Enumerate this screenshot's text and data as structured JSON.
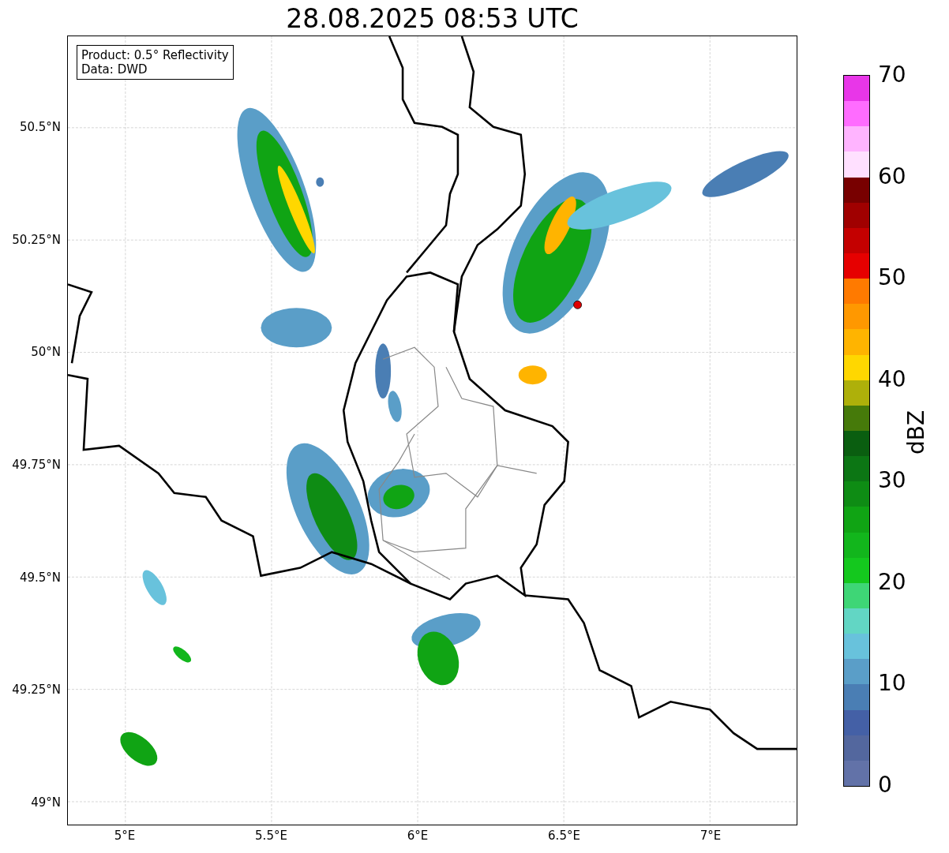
{
  "title": "28.08.2025 08:53 UTC",
  "info_box": {
    "lines": [
      "Product: 0.5° Reflectivity",
      "Data: DWD"
    ]
  },
  "map": {
    "lat_labels": [
      "50.5°N",
      "50.25°N",
      "50°N",
      "49.75°N",
      "49.5°N",
      "49.25°N",
      "49°N"
    ],
    "lon_labels": [
      "5°E",
      "5.5°E",
      "6°E",
      "6.5°E",
      "7°E"
    ]
  },
  "colorbar": {
    "label": "dBZ",
    "ticks": [
      "70",
      "60",
      "50",
      "40",
      "30",
      "20",
      "10",
      "0"
    ],
    "bands": [
      {
        "color": "#e836e8"
      },
      {
        "color": "#ff6cff"
      },
      {
        "color": "#ffb4ff"
      },
      {
        "color": "#ffe0ff"
      },
      {
        "color": "#780000"
      },
      {
        "color": "#a00000"
      },
      {
        "color": "#c40000"
      },
      {
        "color": "#e60000"
      },
      {
        "color": "#ff7a00"
      },
      {
        "color": "#ff9800"
      },
      {
        "color": "#ffb400"
      },
      {
        "color": "#ffd700"
      },
      {
        "color": "#aeb00a"
      },
      {
        "color": "#467a0a"
      },
      {
        "color": "#0a5e10"
      },
      {
        "color": "#0c7614"
      },
      {
        "color": "#0e8c14"
      },
      {
        "color": "#10a414"
      },
      {
        "color": "#12b61c"
      },
      {
        "color": "#14c81e"
      },
      {
        "color": "#3ed676"
      },
      {
        "color": "#62d6c4"
      },
      {
        "color": "#68c2dc"
      },
      {
        "color": "#5a9ec8"
      },
      {
        "color": "#4a7eb4"
      },
      {
        "color": "#4460a6"
      },
      {
        "color": "#53679e"
      },
      {
        "color": "#6272a8"
      }
    ]
  }
}
